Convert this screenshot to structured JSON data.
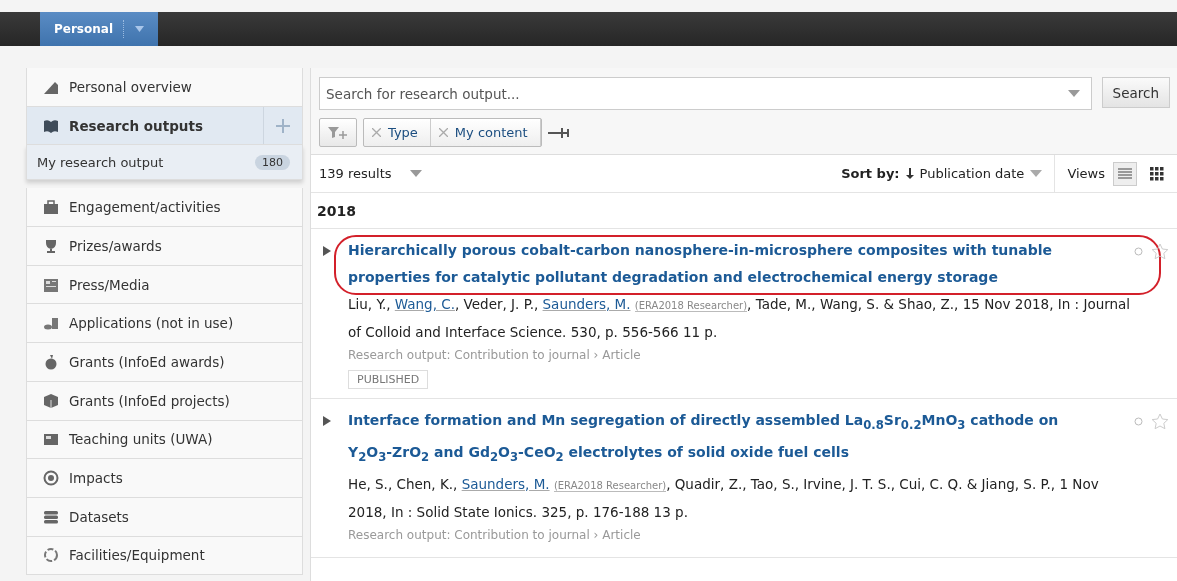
{
  "topbar": {
    "tab": "Personal"
  },
  "sidebar": {
    "items": [
      {
        "label": "Personal overview",
        "selected": false
      },
      {
        "label": "Research outputs",
        "selected": true,
        "sub": {
          "label": "My research output",
          "count": "180"
        }
      },
      {
        "label": "Engagement/activities",
        "selected": false
      },
      {
        "label": "Prizes/awards",
        "selected": false
      },
      {
        "label": "Press/Media",
        "selected": false
      },
      {
        "label": "Applications (not in use)",
        "selected": false
      },
      {
        "label": "Grants (InfoEd awards)",
        "selected": false
      },
      {
        "label": "Grants (InfoEd projects)",
        "selected": false
      },
      {
        "label": "Teaching units (UWA)",
        "selected": false
      },
      {
        "label": "Impacts",
        "selected": false
      },
      {
        "label": "Datasets",
        "selected": false
      },
      {
        "label": "Facilities/Equipment",
        "selected": false
      }
    ]
  },
  "search": {
    "placeholder": "Search for research output...",
    "button": "Search"
  },
  "filters": [
    {
      "label": "Type"
    },
    {
      "label": "My content"
    }
  ],
  "results_bar": {
    "count": "139 results",
    "sort_label": "Sort by:",
    "sort_value": "Publication date",
    "views_label": "Views",
    "views": [
      {
        "kind": "list",
        "selected": true
      },
      {
        "kind": "grid",
        "selected": false
      }
    ]
  },
  "year": "2018",
  "results": [
    {
      "title": "Hierarchically porous cobalt-carbon nanosphere-in-microsphere composites with tunable properties for catalytic pollutant degradation and electrochemical energy storage",
      "highlighted": true,
      "citation": [
        {
          "kind": "plain",
          "text": "Liu, Y., "
        },
        {
          "kind": "link",
          "text": "Wang, C."
        },
        {
          "kind": "plain",
          "text": ", Veder, J. P., "
        },
        {
          "kind": "link",
          "text": "Saunders, M."
        },
        {
          "kind": "tag",
          "text": "(ERA2018 Researcher)"
        },
        {
          "kind": "plain",
          "text": ", Tade, M., Wang, S. & Shao, Z., 15 Nov 2018, In : Journal of Colloid and Interface Science. 530, p. 556-566 11 p."
        }
      ],
      "type": "Research output: Contribution to journal › Article",
      "status": "PUBLISHED"
    },
    {
      "title": "Interface formation and Mn segregation of directly assembled La$_{0.8}$Sr$_{0.2}$MnO$_{3}$ cathode on Y$_{2}$O$_{3}$-ZrO$_{2}$ and Gd$_{2}$O$_{3}$-CeO$_{2}$ electrolytes of solid oxide fuel cells",
      "highlighted": false,
      "citation": [
        {
          "kind": "plain",
          "text": "He, S., Chen, K., "
        },
        {
          "kind": "link",
          "text": "Saunders, M."
        },
        {
          "kind": "tag",
          "text": "(ERA2018 Researcher)"
        },
        {
          "kind": "plain",
          "text": ", Quadir, Z., Tao, S., Irvine, J. T. S., Cui, C. Q. & Jiang, S. P., 1 Nov 2018, In : Solid State Ionics. 325, p. 176-188 13 p."
        }
      ],
      "type": "Research output: Contribution to journal › Article"
    }
  ]
}
